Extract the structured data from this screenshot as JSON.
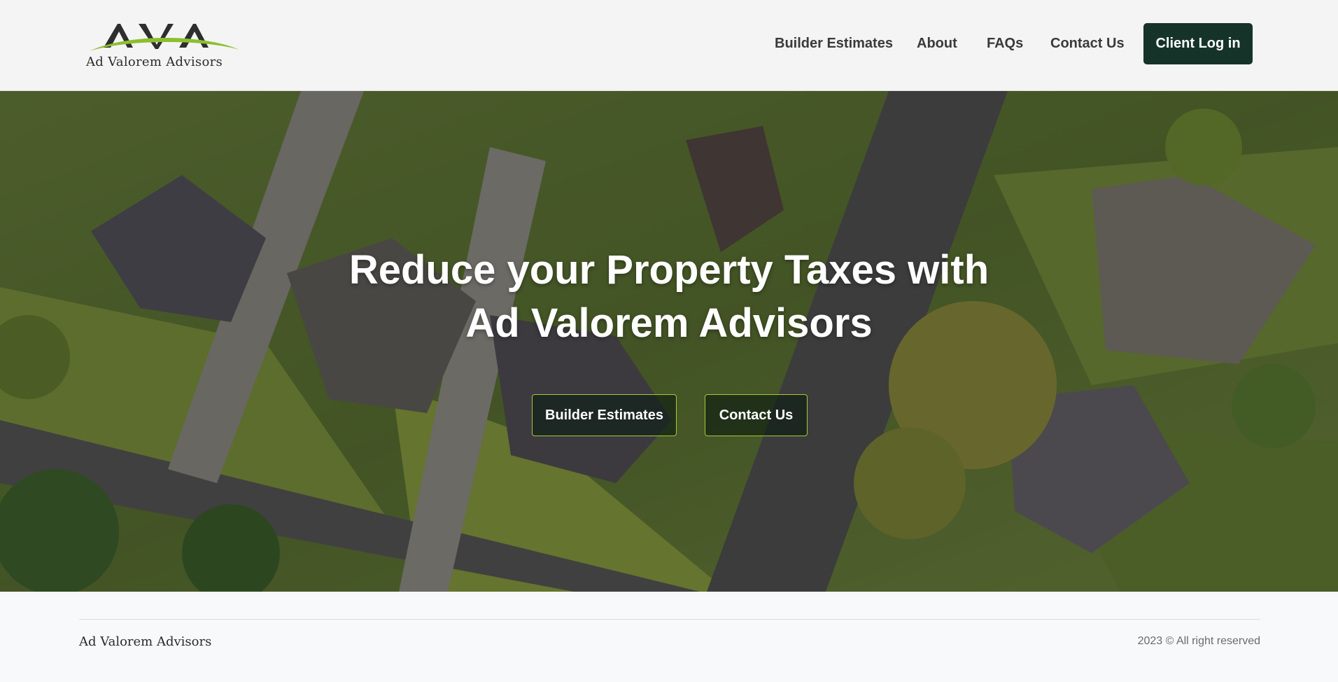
{
  "header": {
    "logo": {
      "monogram": "AVA",
      "wordmark": "Ad Valorem Advisors",
      "accent_color": "#8cbf2d"
    },
    "nav": [
      {
        "label": "Builder Estimates"
      },
      {
        "label": "About"
      },
      {
        "label": "FAQs"
      },
      {
        "label": "Contact Us"
      }
    ],
    "login_label": "Client Log in"
  },
  "hero": {
    "title_line1": "Reduce your Property Taxes with",
    "title_line2": "Ad Valorem Advisors",
    "buttons": [
      {
        "label": "Builder Estimates"
      },
      {
        "label": "Contact Us"
      }
    ],
    "background": "aerial-neighborhood-image"
  },
  "footer": {
    "brand": "Ad Valorem Advisors",
    "copyright": "2023 © All right reserved"
  },
  "colors": {
    "header_bg": "#f4f4f4",
    "login_button": "#16332a",
    "hero_button_border": "#a4c936",
    "footer_bg": "#f8f9fb"
  }
}
